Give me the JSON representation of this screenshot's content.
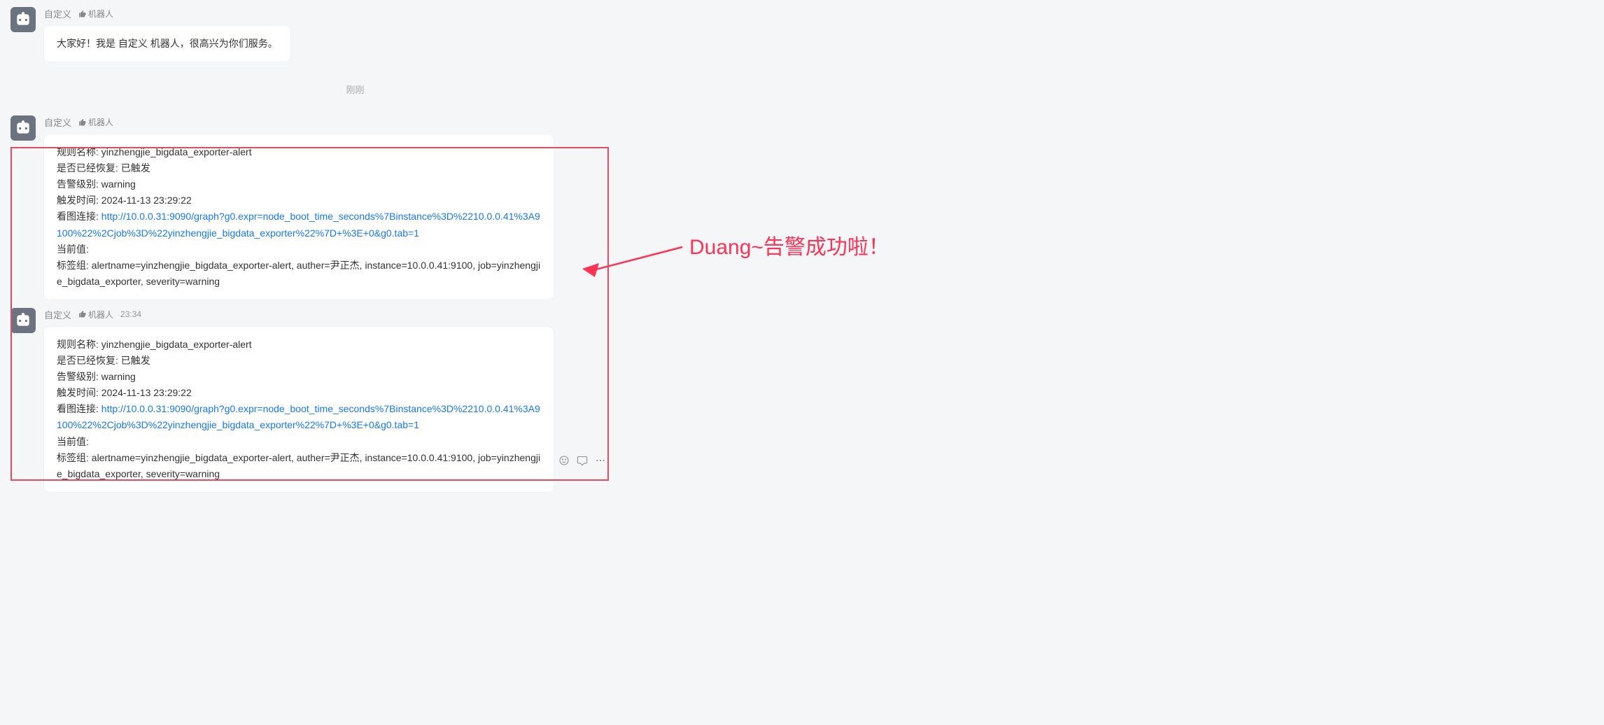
{
  "sender": {
    "name": "自定义",
    "bot_label": "机器人"
  },
  "timeline": {
    "just_now": "刚刚"
  },
  "intro": {
    "text": "大家好！我是 自定义 机器人，很高兴为你们服务。"
  },
  "alert": {
    "rule_label": "规则名称:",
    "rule_value": "yinzhengjie_bigdata_exporter-alert",
    "status_label": "是否已经恢复:",
    "status_value": "已触发",
    "level_label": "告警级别:",
    "level_value": "warning",
    "trigger_label": "触发时间:",
    "trigger_value": "2024-11-13 23:29:22",
    "link_label": "看图连接:",
    "link_value": "http://10.0.0.31:9090/graph?g0.expr=node_boot_time_seconds%7Binstance%3D%2210.0.0.41%3A9100%22%2Cjob%3D%22yinzhengjie_bigdata_exporter%22%7D+%3E+0&g0.tab=1",
    "current_label": "当前值:",
    "tags_label": "标签组:",
    "tags_value": "alertname=yinzhengjie_bigdata_exporter-alert, auther=尹正杰, instance=10.0.0.41:9100, job=yinzhengjie_bigdata_exporter, severity=warning"
  },
  "msg3_time": "23:34",
  "annotation": {
    "text": "Duang~告警成功啦！"
  }
}
